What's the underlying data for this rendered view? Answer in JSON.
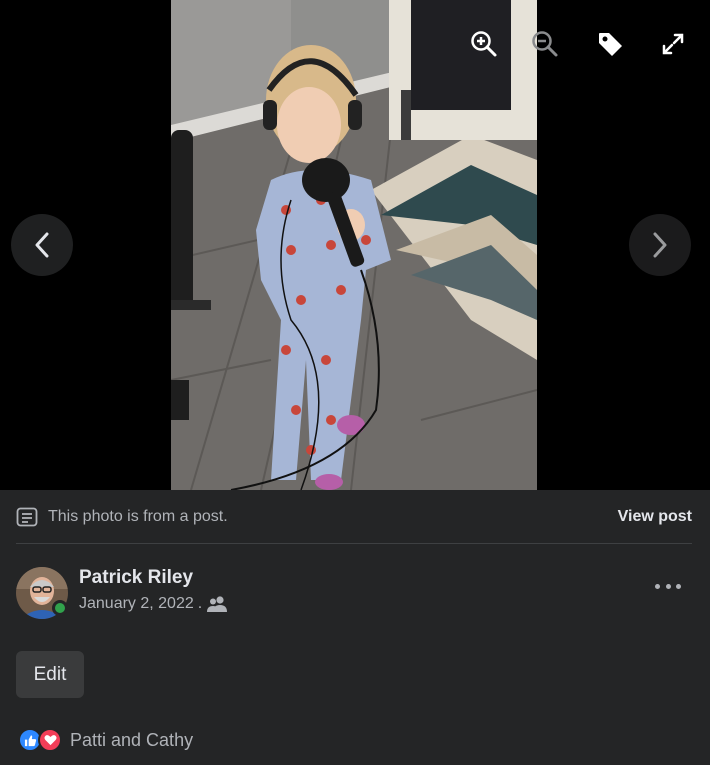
{
  "viewer": {
    "prev_icon": "chevron-left-icon",
    "next_icon": "chevron-right-icon",
    "toolbar_icons": [
      "zoom-in-icon",
      "zoom-out-icon",
      "tag-icon",
      "fullscreen-icon"
    ]
  },
  "post_banner": {
    "text": "This photo is from a post.",
    "link_label": "View post",
    "icon": "post-icon"
  },
  "author": {
    "name": "Patrick Riley",
    "date": "January 2, 2022",
    "separator": ".",
    "audience_icon": "friends-icon",
    "online": true
  },
  "actions": {
    "edit_label": "Edit",
    "more_icon": "more-icon"
  },
  "reactions": {
    "icons": [
      "like-icon",
      "love-icon"
    ],
    "names": "Patti and Cathy"
  },
  "colors": {
    "background": "#242526",
    "text": "#e4e6eb",
    "secondary_text": "#b0b3b8",
    "like_blue": "#2d88ff",
    "love_red": "#f33e58",
    "online_green": "#31a24c"
  }
}
